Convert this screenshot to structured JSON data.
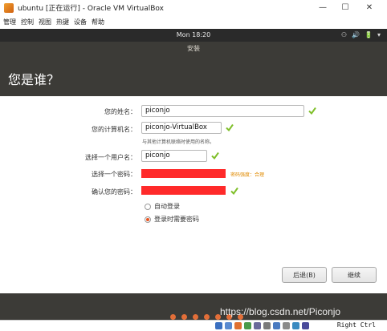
{
  "window": {
    "title": "ubuntu [正在运行] - Oracle VM VirtualBox",
    "minimize": "—",
    "maximize": "☐",
    "close": "✕"
  },
  "menu": [
    "管理",
    "控制",
    "视图",
    "热键",
    "设备",
    "帮助"
  ],
  "guest_top": {
    "clock": "Mon 18:20",
    "tray": [
      "⚇",
      "🔊",
      "🔋",
      "▾"
    ]
  },
  "installer": {
    "title": "安装",
    "heading": "您是谁？"
  },
  "form": {
    "name_label": "您的姓名：",
    "name_value": "piconjo",
    "computer_label": "您的计算机名：",
    "computer_value": "piconjo-VirtualBox",
    "computer_hint": "与其他计算机联络时使用的名称。",
    "username_label": "选择一个用户名：",
    "username_value": "piconjo",
    "password_label": "选择一个密码：",
    "password_strength": "密码强度：合理",
    "confirm_label": "确认您的密码：",
    "autologin_label": "自动登录",
    "require_password_label": "登录时需要密码",
    "selected_login_option": "登录时需要密码"
  },
  "buttons": {
    "back": "后退(B)",
    "continue": "继续"
  },
  "footer": {
    "watermark": "https://blog.csdn.net/Piconjo",
    "host_key": "Right Ctrl"
  },
  "colors": {
    "accent": "#e95420",
    "check_green": "#7fbf2a",
    "redaction": "#ff2a2a"
  }
}
